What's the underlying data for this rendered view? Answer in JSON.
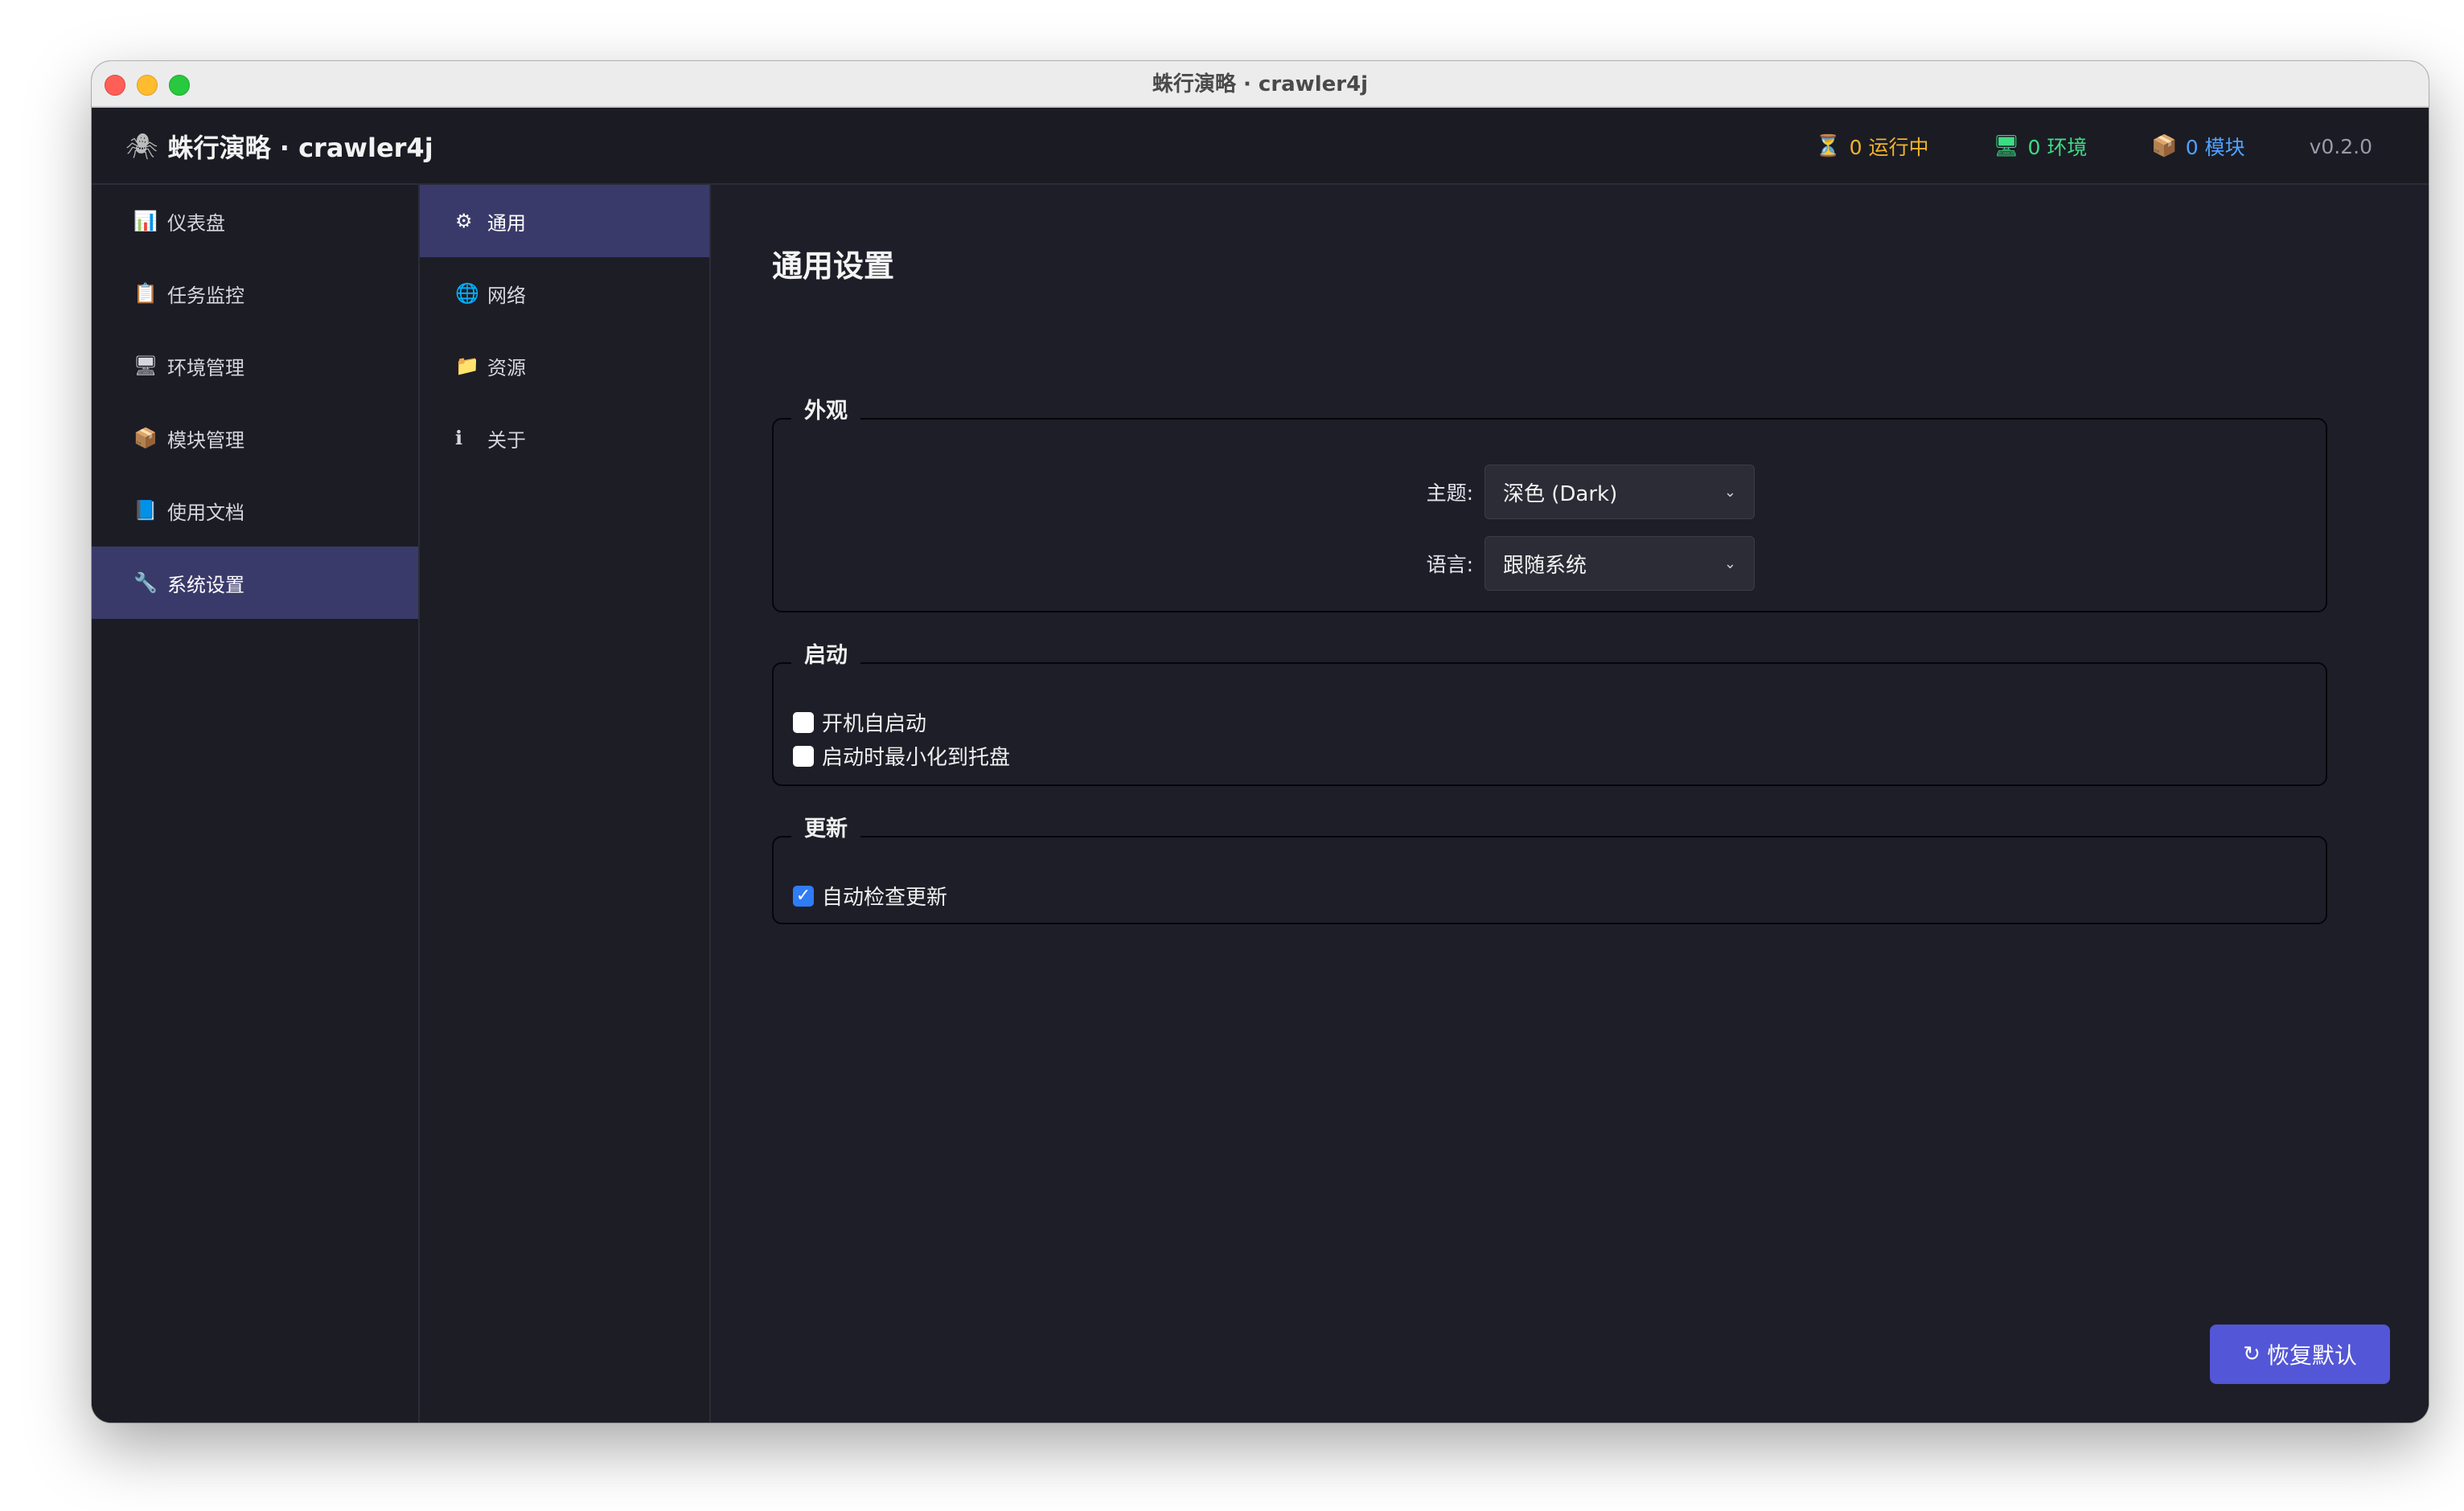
{
  "window": {
    "title": "蛛行演略 · crawler4j"
  },
  "header": {
    "brand_icon": "spider-icon",
    "brand_name": "蛛行演略 · crawler4j",
    "running": "0 运行中",
    "environments": "0 环境",
    "modules": "0 模块",
    "version": "v0.2.0"
  },
  "sidebar": {
    "items": [
      {
        "icon": "chart-icon",
        "label": "仪表盘"
      },
      {
        "icon": "clipboard-icon",
        "label": "任务监控"
      },
      {
        "icon": "monitor-icon",
        "label": "环境管理"
      },
      {
        "icon": "package-icon",
        "label": "模块管理"
      },
      {
        "icon": "book-icon",
        "label": "使用文档"
      },
      {
        "icon": "wrench-icon",
        "label": "系统设置"
      }
    ],
    "active": 5
  },
  "subnav": {
    "items": [
      {
        "icon": "gear-icon",
        "label": "通用"
      },
      {
        "icon": "globe-icon",
        "label": "网络"
      },
      {
        "icon": "folder-icon",
        "label": "资源"
      },
      {
        "icon": "info-icon",
        "label": "关于"
      }
    ],
    "active": 0
  },
  "main": {
    "title": "通用设置",
    "appearance": {
      "legend": "外观",
      "theme_label": "主题:",
      "theme_value": "深色 (Dark)",
      "language_label": "语言:",
      "language_value": "跟随系统"
    },
    "startup": {
      "legend": "启动",
      "launch_at_login": {
        "label": "开机自启动",
        "checked": false
      },
      "minimize_to_tray": {
        "label": "启动时最小化到托盘",
        "checked": false
      }
    },
    "update": {
      "legend": "更新",
      "auto_check": {
        "label": "自动检查更新",
        "checked": true
      }
    },
    "reset_button": "恢复默认"
  },
  "colors": {
    "accent": "#5356d6",
    "active_nav": "#3a3a6a",
    "running": "#f0b429",
    "environments": "#3ddc84",
    "modules": "#4da3ff"
  }
}
